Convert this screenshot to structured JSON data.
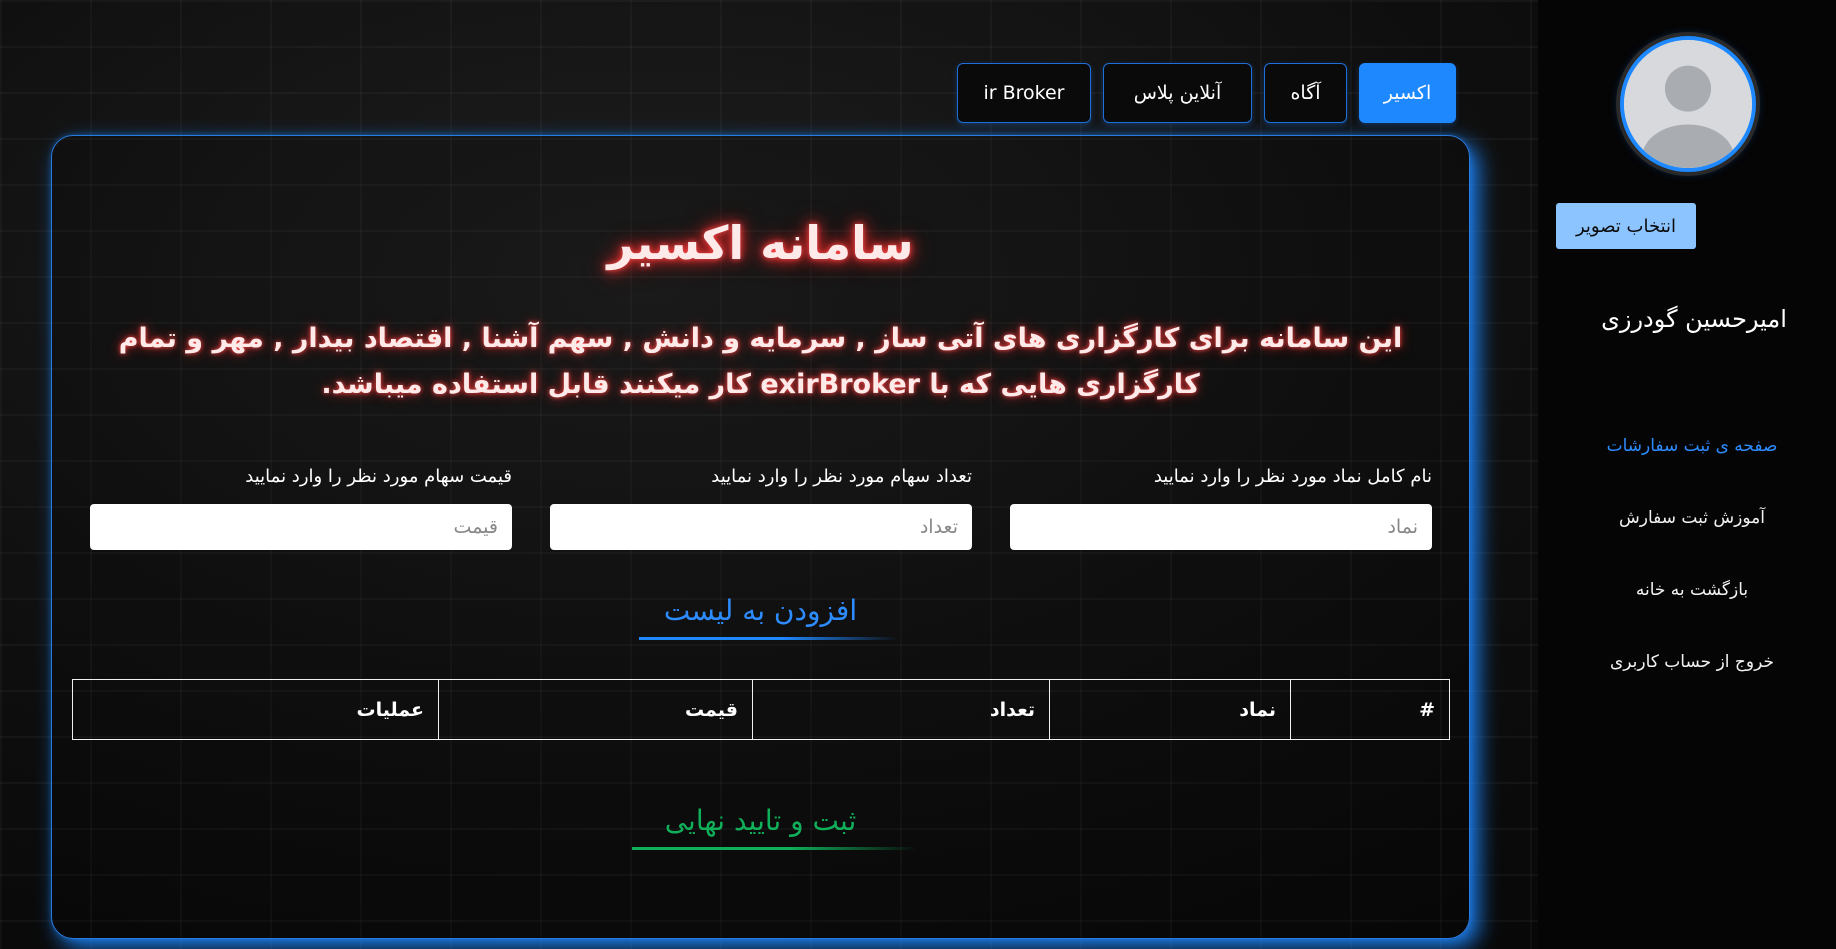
{
  "sidebar": {
    "choose_image_label": "انتخاب تصویر",
    "user_name": "امیرحسین گودرزی",
    "nav": [
      {
        "label": "صفحه ی ثبت سفارشات",
        "active": true
      },
      {
        "label": "آموزش ثبت سفارش",
        "active": false
      },
      {
        "label": "بازگشت به خانه",
        "active": false
      },
      {
        "label": "خروج از حساب کاربری",
        "active": false
      }
    ]
  },
  "tabs": [
    {
      "label": "اکسیر",
      "active": true
    },
    {
      "label": "آگاه",
      "active": false
    },
    {
      "label": "آنلاین پلاس",
      "active": false
    },
    {
      "label": "ir Broker",
      "active": false
    }
  ],
  "main": {
    "title": "سامانه اکسیر",
    "description": "این سامانه برای کارگزاری های آتی ساز , سرمایه و دانش , سهم آشنا , اقتصاد بیدار , مهر و تمام کارگزاری هایی که با exirBroker کار میکنند قابل استفاده میباشد.",
    "fields": {
      "symbol": {
        "label": "نام کامل نماد مورد نظر را وارد نمایید",
        "placeholder": "نماد",
        "value": ""
      },
      "quantity": {
        "label": "تعداد سهام مورد نظر را وارد نمایید",
        "placeholder": "تعداد",
        "value": ""
      },
      "price": {
        "label": "قیمت سهام مورد نظر را وارد نمایید",
        "placeholder": "قیمت",
        "value": ""
      }
    },
    "add_to_list_label": "افزودن به لیست",
    "table": {
      "headers": [
        "#",
        "نماد",
        "تعداد",
        "قیمت",
        "عملیات"
      ],
      "rows": []
    },
    "final_submit_label": "ثبت و تایید نهایی"
  },
  "colors": {
    "accent": "#1e88ff",
    "success": "#10b05a",
    "title_glow": "#ff3a3a"
  }
}
